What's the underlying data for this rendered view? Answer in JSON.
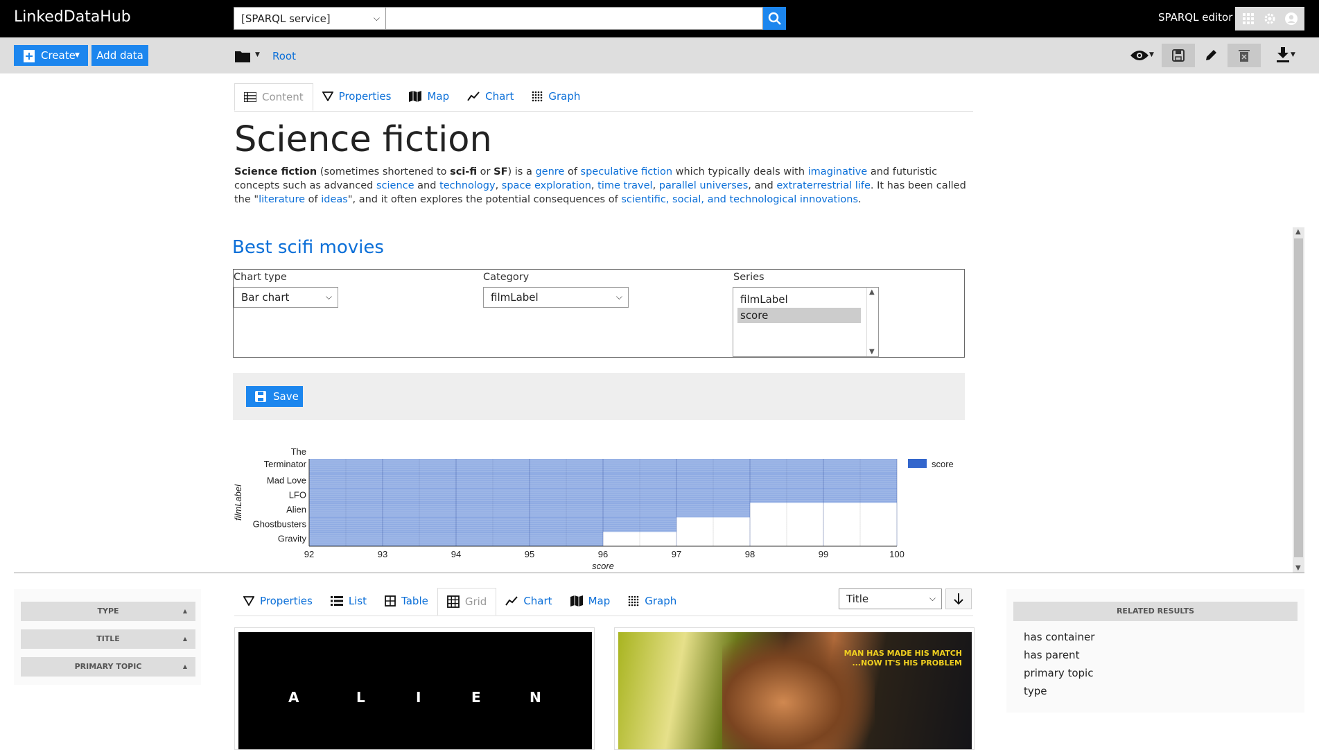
{
  "app": {
    "brand": "LinkedDataHub",
    "service_select": "[SPARQL service]",
    "search_placeholder": "",
    "sparql_editor": "SPARQL editor"
  },
  "toolbar": {
    "create": "Create",
    "add_data": "Add data",
    "breadcrumb_root": "Root"
  },
  "content_tabs": [
    {
      "label": "Content",
      "icon": "content-icon"
    },
    {
      "label": "Properties",
      "icon": "properties-icon"
    },
    {
      "label": "Map",
      "icon": "map-icon"
    },
    {
      "label": "Chart",
      "icon": "chart-icon"
    },
    {
      "label": "Graph",
      "icon": "graph-icon"
    }
  ],
  "page": {
    "title": "Science fiction",
    "desc": {
      "b1": "Science fiction",
      "t1": " (sometimes shortened to ",
      "b2": "sci-fi",
      "t2": " or ",
      "b3": "SF",
      "t3": ") is a ",
      "l1": "genre",
      "t4": " of ",
      "l2": "speculative fiction",
      "t5": " which typically deals with ",
      "l3": "imaginative",
      "t6": " and futuristic concepts such as advanced ",
      "l4": "science",
      "t7": " and ",
      "l5": "technology",
      "t8": ", ",
      "l6": "space exploration",
      "t9": ", ",
      "l7": "time travel",
      "t10": ", ",
      "l8": "parallel universes",
      "t11": ", and ",
      "l9": "extraterrestrial life",
      "t12": ". It has been called the \"",
      "l10": "literature",
      "t13": " of ",
      "l11": "ideas",
      "t14": "\", and it often explores the potential consequences of ",
      "l12": "scientific, social, and technological innovations",
      "t15": "."
    }
  },
  "chart_section": {
    "heading": "Best scifi movies",
    "chart_type_label": "Chart type",
    "chart_type_value": "Bar chart",
    "category_label": "Category",
    "category_value": "filmLabel",
    "series_label": "Series",
    "series_options": [
      "filmLabel",
      "score"
    ],
    "save_label": "Save"
  },
  "chart_data": {
    "type": "bar",
    "orientation": "horizontal",
    "categories": [
      "The Terminator",
      "Mad Love",
      "LFO",
      "Alien",
      "Ghostbusters",
      "Gravity"
    ],
    "series": [
      {
        "name": "score",
        "values": [
          100,
          100,
          100,
          98,
          97,
          96
        ]
      }
    ],
    "xlabel": "score",
    "ylabel": "filmLabel",
    "xlim": [
      92,
      100
    ],
    "xticks": [
      92,
      93,
      94,
      95,
      96,
      97,
      98,
      99,
      100
    ],
    "legend": "top-right",
    "grid": true,
    "color": "#3366cc"
  },
  "results_tabs": [
    {
      "label": "Properties",
      "icon": "properties-icon"
    },
    {
      "label": "List",
      "icon": "list-icon"
    },
    {
      "label": "Table",
      "icon": "table-icon"
    },
    {
      "label": "Grid",
      "icon": "grid-icon"
    },
    {
      "label": "Chart",
      "icon": "chart-icon"
    },
    {
      "label": "Map",
      "icon": "map-icon"
    },
    {
      "label": "Graph",
      "icon": "graph-icon"
    }
  ],
  "sort": {
    "value": "Title"
  },
  "facets": [
    "TYPE",
    "TITLE",
    "PRIMARY TOPIC"
  ],
  "related": {
    "header": "RELATED RESULTS",
    "items": [
      "has container",
      "has parent",
      "primary topic",
      "type"
    ]
  },
  "cards": {
    "alien_letters": [
      "A",
      "L",
      "I",
      "E",
      "N"
    ],
    "bladerunner_tagline1": "MAN HAS MADE HIS MATCH",
    "bladerunner_tagline2": "...NOW IT'S HIS PROBLEM"
  }
}
